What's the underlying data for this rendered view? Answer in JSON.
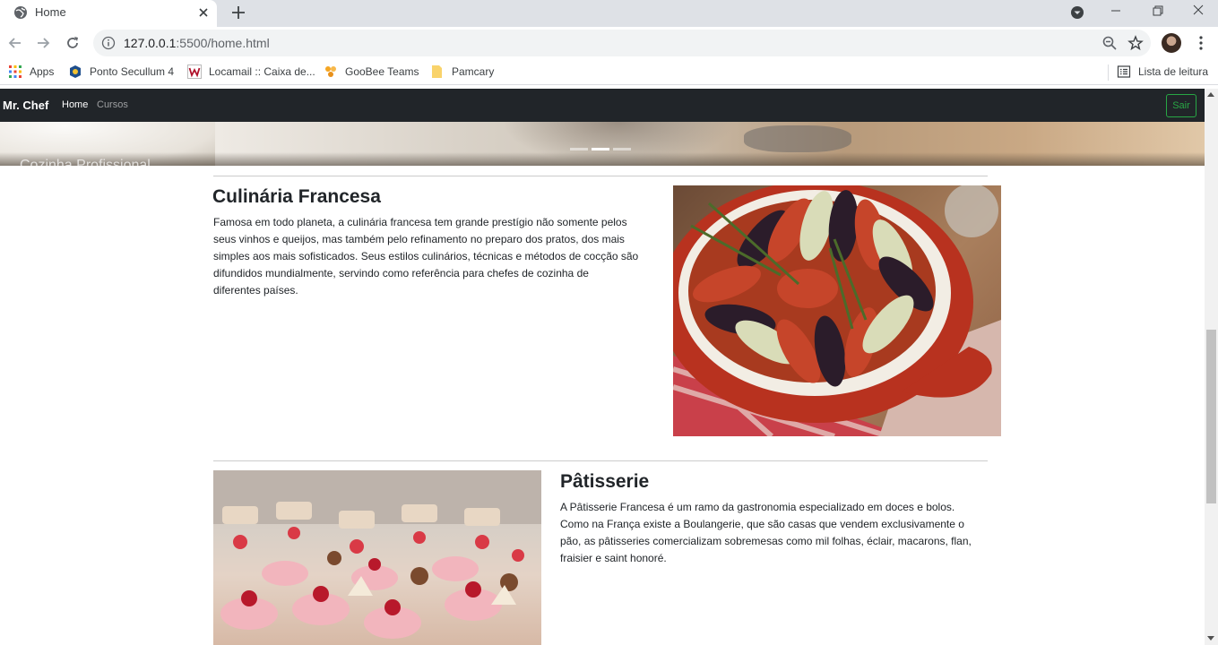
{
  "browser": {
    "tab_title": "Home",
    "url_host": "127.0.0.1",
    "url_rest": ":5500/home.html",
    "bookmarks": [
      {
        "label": "Apps",
        "icon": "apps-grid-icon"
      },
      {
        "label": "Ponto Secullum 4",
        "icon": "secullum-icon"
      },
      {
        "label": "Locamail :: Caixa de...",
        "icon": "locamail-icon"
      },
      {
        "label": "GooBee Teams",
        "icon": "goobee-icon"
      },
      {
        "label": "Pamcary",
        "icon": "folder-icon"
      }
    ],
    "reading_list": "Lista de leitura"
  },
  "navbar": {
    "brand": "Mr. Chef",
    "links": [
      "Home",
      "Cursos"
    ],
    "logout": "Sair"
  },
  "carousel": {
    "caption": "Cozinha Profissional",
    "indicators": 3,
    "active_index": 1
  },
  "sections": [
    {
      "title": "Culinária Francesa",
      "text_lines": [
        "Famosa em todo planeta, a culinária francesa tem grande prestígio não somente pelos",
        "seus vinhos e queijos, mas também pelo refinamento no preparo dos pratos, dos mais",
        "simples aos mais sofisticados. Seus estilos culinários, técnicas e métodos de cocção são",
        "difundidos mundialmente, servindo como referência para chefes de cozinha de",
        "diferentes países."
      ]
    },
    {
      "title": "Pâtisserie",
      "text_lines": [
        "A Pâtisserie Francesa é um ramo da gastronomia especializado em doces e bolos.",
        "Como na França existe a Boulangerie, que são casas que vendem exclusivamente o",
        "pão, as pâtisseries comercializam sobremesas como mil folhas, éclair, macarons, flan,",
        "fraisier e saint honoré."
      ]
    }
  ],
  "colors": {
    "navbar_bg": "#212529",
    "accent_green": "#28a745",
    "chrome_bg": "#dee1e6"
  }
}
